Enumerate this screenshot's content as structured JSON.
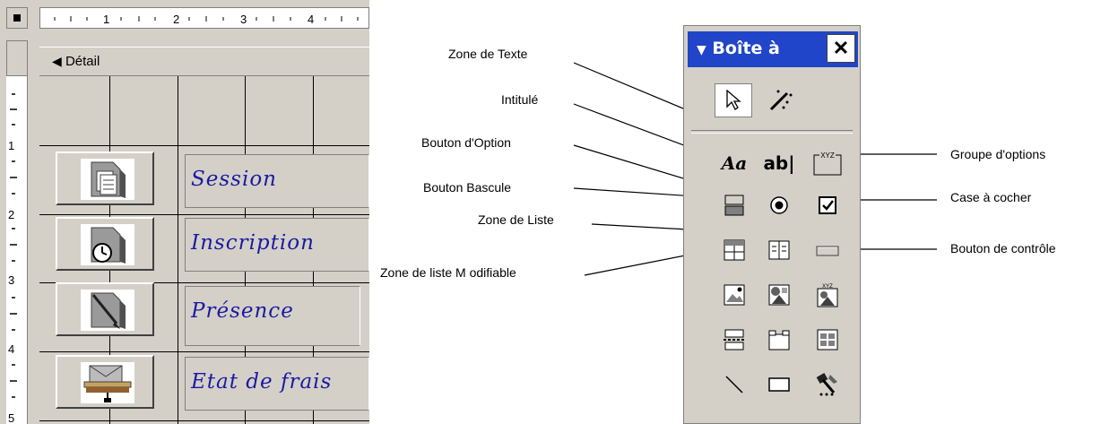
{
  "ruler": {
    "top_marks": [
      "1",
      "2",
      "3",
      "4"
    ],
    "side_marks": [
      "1",
      "2",
      "3",
      "4",
      "5"
    ]
  },
  "designer": {
    "section_label": "Détail",
    "rows": [
      {
        "label": "Session",
        "icon": "folder-documents-icon"
      },
      {
        "label": "Inscription",
        "icon": "folder-clock-icon"
      },
      {
        "label": "Présence",
        "icon": "folder-pen-icon"
      },
      {
        "label": "Etat de frais",
        "icon": "envelope-printer-icon"
      }
    ]
  },
  "toolbox": {
    "title": "Boîte à",
    "close": "✕",
    "tools": [
      {
        "name": "select-pointer-icon"
      },
      {
        "name": "control-wizard-icon"
      },
      {
        "name": "label-tool-icon",
        "glyph": "Aa"
      },
      {
        "name": "textbox-tool-icon",
        "glyph": "ab|"
      },
      {
        "name": "option-group-icon",
        "glyph": "XYZ"
      }
    ]
  },
  "annotations": {
    "zone_texte": "Zone de Texte",
    "intitule": "Intitulé",
    "bouton_option": "Bouton d'Option",
    "bouton_bascule": "Bouton Bascule",
    "zone_liste": "Zone de Liste",
    "zone_liste_modifiable": "Zone de liste M odifiable",
    "groupe_options": "Groupe d'options",
    "case_cocher": "Case à cocher",
    "bouton_controle": "Bouton de contrôle"
  }
}
